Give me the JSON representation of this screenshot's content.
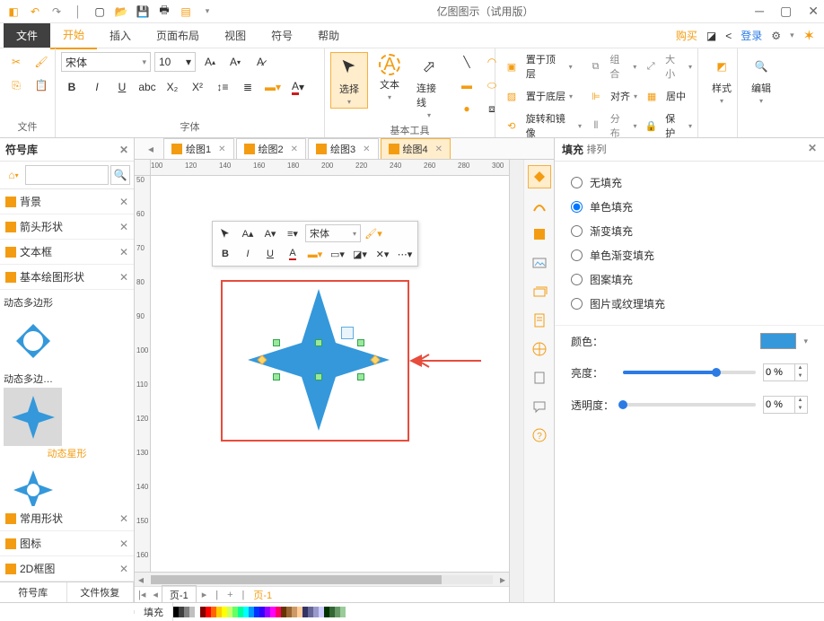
{
  "title": "亿图图示（试用版）",
  "menu": {
    "file": "文件",
    "tabs": [
      "开始",
      "插入",
      "页面布局",
      "视图",
      "符号",
      "帮助"
    ],
    "active": 0,
    "buy": "购买",
    "login": "登录"
  },
  "ribbon": {
    "fileGroup": "文件",
    "fontGroup": "字体",
    "fontName": "宋体",
    "fontSize": "10",
    "basicTools": "基本工具",
    "select": "选择",
    "text": "文本",
    "connector": "连接线",
    "arrangeGroup": "排列",
    "bringFront": "置于顶层",
    "sendBack": "置于底层",
    "rotateMirror": "旋转和镜像",
    "group": "组合",
    "align": "对齐",
    "distribute": "分布",
    "size": "大小",
    "center": "居中",
    "lock": "保护",
    "style": "样式",
    "edit": "编辑"
  },
  "leftPanel": {
    "title": "符号库",
    "categories": [
      "背景",
      "箭头形状",
      "文本框",
      "基本绘图形状"
    ],
    "shapes": {
      "polyLabel": "动态多边形",
      "polyShort": "动态多边…",
      "starLabel": "动态星形"
    },
    "moreCats": [
      "常用形状",
      "图标",
      "2D框图"
    ],
    "bottomTabs": [
      "符号库",
      "文件恢复"
    ]
  },
  "docTabs": [
    {
      "name": "绘图1"
    },
    {
      "name": "绘图2"
    },
    {
      "name": "绘图3"
    },
    {
      "name": "绘图4"
    }
  ],
  "activeDocTab": 3,
  "rulerH": [
    "100",
    "120",
    "140",
    "160",
    "180",
    "200",
    "220",
    "240",
    "260",
    "280",
    "300"
  ],
  "rulerV": [
    "50",
    "60",
    "70",
    "80",
    "90",
    "100",
    "110",
    "120",
    "130",
    "140",
    "150",
    "160"
  ],
  "floatbar": {
    "font": "宋体"
  },
  "rightPanel": {
    "title": "填充",
    "options": [
      "无填充",
      "单色填充",
      "渐变填充",
      "单色渐变填充",
      "图案填充",
      "图片或纹理填充"
    ],
    "selectedOption": 1,
    "colorLabel": "颜色：",
    "brightLabel": "亮度：",
    "brightVal": "0 %",
    "brightPos": 70,
    "opacityLabel": "透明度：",
    "opacityVal": "0 %",
    "opacityPos": 0
  },
  "status": {
    "fill": "填充",
    "page": "页-1",
    "pageOrange": "页-1"
  },
  "palette": [
    "#000000",
    "#404040",
    "#808080",
    "#c0c0c0",
    "#ffffff",
    "#800000",
    "#ff0000",
    "#ff6600",
    "#ffcc00",
    "#ffff00",
    "#ccff66",
    "#66ff66",
    "#00ff99",
    "#00ffff",
    "#0099ff",
    "#0033ff",
    "#3300ff",
    "#9900ff",
    "#ff00ff",
    "#ff0066",
    "#663300",
    "#996633",
    "#cc9966",
    "#ffcc99",
    "#333366",
    "#666699",
    "#9999cc",
    "#ccccff",
    "#003300",
    "#336633",
    "#669966",
    "#99cc99"
  ]
}
